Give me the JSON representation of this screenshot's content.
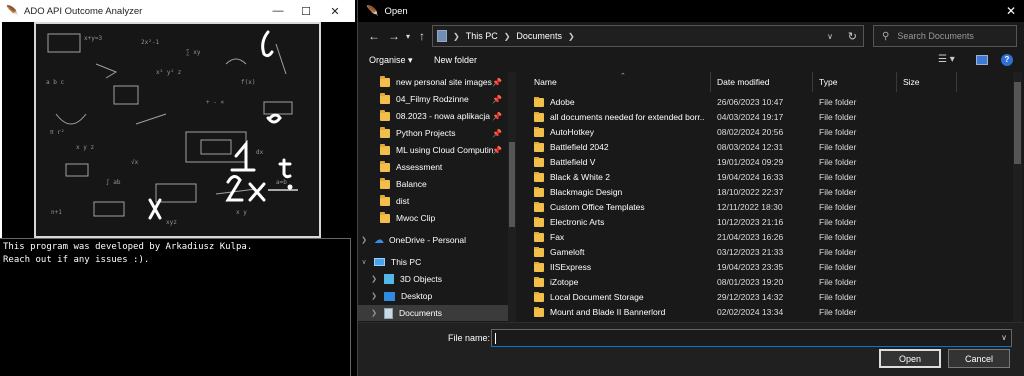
{
  "app": {
    "title": "ADO API Outcome Analyzer",
    "console_lines": [
      "This program was developed by Arkadiusz Kulpa.",
      "Reach out if any issues :)."
    ]
  },
  "dialog": {
    "title": "Open",
    "breadcrumb": [
      "This PC",
      "Documents"
    ],
    "search_placeholder": "Search Documents",
    "toolbar": {
      "organise": "Organise ▾",
      "new_folder": "New folder"
    },
    "nav_items": [
      {
        "label": "new personal site images",
        "pinned": true,
        "kind": "folder"
      },
      {
        "label": "04_Filmy Rodzinne",
        "pinned": true,
        "kind": "folder"
      },
      {
        "label": "08.2023 - nowa aplikacja",
        "pinned": true,
        "kind": "folder"
      },
      {
        "label": "Python Projects",
        "pinned": true,
        "kind": "folder"
      },
      {
        "label": "ML using Cloud Computin",
        "pinned": true,
        "kind": "folder"
      },
      {
        "label": "Assessment",
        "pinned": false,
        "kind": "folder"
      },
      {
        "label": "Balance",
        "pinned": false,
        "kind": "folder"
      },
      {
        "label": "dist",
        "pinned": false,
        "kind": "folder"
      },
      {
        "label": "Mwoc Clip",
        "pinned": false,
        "kind": "folder"
      },
      {
        "label": "OneDrive - Personal",
        "pinned": false,
        "kind": "cloud"
      },
      {
        "label": "This PC",
        "pinned": false,
        "kind": "pc"
      },
      {
        "label": "3D Objects",
        "pinned": false,
        "kind": "3d"
      },
      {
        "label": "Desktop",
        "pinned": false,
        "kind": "desktop"
      },
      {
        "label": "Documents",
        "pinned": false,
        "kind": "docs"
      }
    ],
    "columns": [
      "Name",
      "Date modified",
      "Type",
      "Size"
    ],
    "files": [
      {
        "name": "Adobe",
        "date": "26/06/2023 10:47",
        "type": "File folder"
      },
      {
        "name": "all documents needed for extended borr...",
        "date": "04/03/2024 19:17",
        "type": "File folder"
      },
      {
        "name": "AutoHotkey",
        "date": "08/02/2024 20:56",
        "type": "File folder"
      },
      {
        "name": "Battlefield 2042",
        "date": "08/03/2024 12:31",
        "type": "File folder"
      },
      {
        "name": "Battlefield V",
        "date": "19/01/2024 09:29",
        "type": "File folder"
      },
      {
        "name": "Black & White 2",
        "date": "19/04/2024 16:33",
        "type": "File folder"
      },
      {
        "name": "Blackmagic Design",
        "date": "18/10/2022 22:37",
        "type": "File folder"
      },
      {
        "name": "Custom Office Templates",
        "date": "12/11/2022 18:30",
        "type": "File folder"
      },
      {
        "name": "Electronic Arts",
        "date": "10/12/2023 21:16",
        "type": "File folder"
      },
      {
        "name": "Fax",
        "date": "21/04/2023 16:26",
        "type": "File folder"
      },
      {
        "name": "Gameloft",
        "date": "03/12/2023 21:33",
        "type": "File folder"
      },
      {
        "name": "IISExpress",
        "date": "19/04/2023 23:35",
        "type": "File folder"
      },
      {
        "name": "iZotope",
        "date": "08/01/2023 19:20",
        "type": "File folder"
      },
      {
        "name": "Local Document Storage",
        "date": "29/12/2023 14:32",
        "type": "File folder"
      },
      {
        "name": "Mount and Blade II Bannerlord",
        "date": "02/02/2024 13:34",
        "type": "File folder"
      }
    ],
    "file_name_label": "File name:",
    "file_name_value": "",
    "open_label": "Open",
    "cancel_label": "Cancel",
    "colors": {
      "folder": "#f2c04a",
      "selected": "#3b3b3b",
      "accent": "#0078d7"
    }
  }
}
